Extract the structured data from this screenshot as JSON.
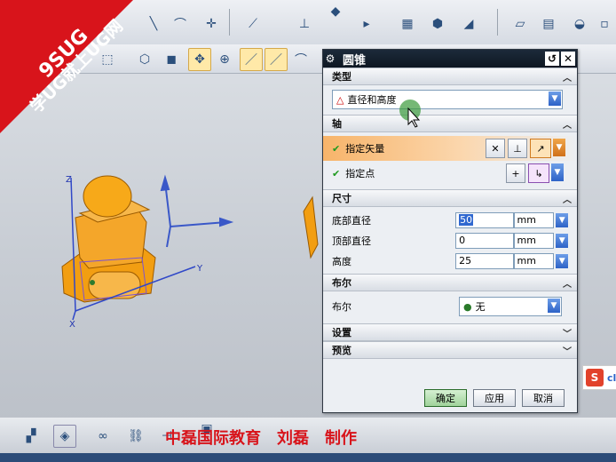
{
  "banner": {
    "line1": "9SUG",
    "line2": "学UG就上UG网"
  },
  "dialog": {
    "title": "圆锥",
    "type_section": {
      "label": "类型",
      "value": "直径和高度"
    },
    "axis_section": {
      "label": "轴",
      "specify_vector": "指定矢量",
      "specify_point": "指定点"
    },
    "dimensions_section": {
      "label": "尺寸",
      "fields": [
        {
          "label": "底部直径",
          "value": "50",
          "unit": "mm"
        },
        {
          "label": "顶部直径",
          "value": "0",
          "unit": "mm"
        },
        {
          "label": "高度",
          "value": "25",
          "unit": "mm"
        }
      ]
    },
    "boolean_section": {
      "label": "布尔",
      "field_label": "布尔",
      "value": "无"
    },
    "settings_section": {
      "label": "设置"
    },
    "preview_section": {
      "label": "预览"
    },
    "buttons": {
      "ok": "确定",
      "apply": "应用",
      "cancel": "取消"
    }
  },
  "axes": {
    "x": "X",
    "y": "Y",
    "z": "Z"
  },
  "credit": "中磊国际教育　刘磊　制作",
  "side_logo": "cl"
}
